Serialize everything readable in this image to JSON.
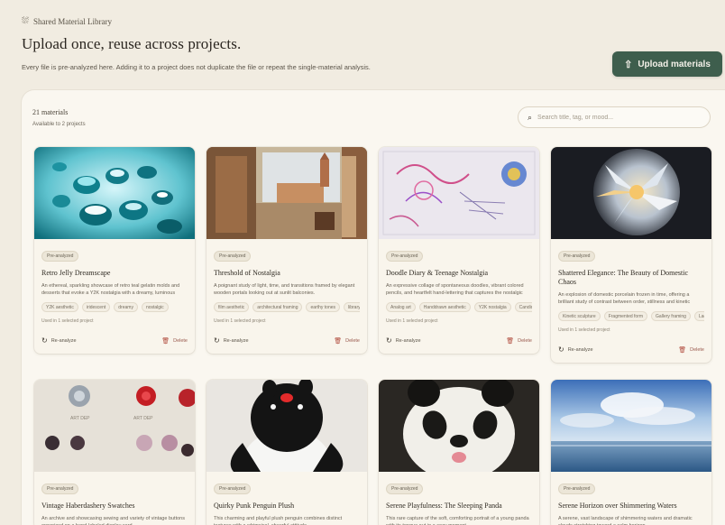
{
  "header": {
    "eyebrow": "Shared Material Library",
    "title": "Upload once, reuse across projects.",
    "description": "Every file is pre-analyzed here. Adding it to a project does not duplicate the file or repeat the single-material analysis."
  },
  "upload_button": {
    "label": "Upload materials",
    "icon": "upload-icon"
  },
  "library": {
    "count_label": "21 materials",
    "available_label": "Available to 2 projects",
    "search_placeholder": "Search title, tag, or mood..."
  },
  "cards": [
    {
      "badge": "Pre-analyzed",
      "title": "Retro Jelly Dreamscape",
      "description": "An ethereal, sparkling showcase of retro teal gelatin molds and desserts that evoke a Y2K nostalgia with a dreamy, luminous aesthetic.",
      "tags": [
        "Y2K aesthetic",
        "iridescent",
        "dreamy",
        "nostalgic"
      ],
      "used": "Used in 1 selected project",
      "reanalyze": "Re-analyze",
      "delete": "Delete"
    },
    {
      "badge": "Pre-analyzed",
      "title": "Threshold of Nostalgia",
      "description": "A poignant study of light, time, and transitions framed by elegant wooden portals looking out at sunlit balconies.",
      "tags": [
        "film aesthetic",
        "architectural framing",
        "earthy tones",
        "library"
      ],
      "used": "Used in 1 selected project",
      "reanalyze": "Re-analyze",
      "delete": "Delete"
    },
    {
      "badge": "Pre-analyzed",
      "title": "Doodle Diary & Teenage Nostalgia",
      "description": "An expressive collage of spontaneous doodles, vibrant colored pencils, and heartfelt hand-lettering that captures the nostalgic charm of a teenager's private notebook.",
      "tags": [
        "Analog art",
        "Handdrawn aesthetic",
        "Y2K nostalgia",
        "Candid"
      ],
      "used": "Used in 1 selected project",
      "reanalyze": "Re-analyze",
      "delete": "Delete"
    },
    {
      "badge": "Pre-analyzed",
      "title": "Shattered Elegance: The Beauty of Domestic Chaos",
      "description": "An explosion of domestic porcelain frozen in time, offering a brilliant study of contrast between order, stillness and kinetic energy in a single frame of light.",
      "tags": [
        "Kinetic sculpture",
        "Fragmented form",
        "Gallery framing",
        "Lacquer"
      ],
      "used": "Used in 1 selected project",
      "reanalyze": "Re-analyze",
      "delete": "Delete"
    },
    {
      "badge": "Pre-analyzed",
      "title": "Vintage Haberdashery Swatches",
      "description": "An archive and showcasing sewing and variety of vintage buttons organized on a hand-labeled display card.",
      "tags": [],
      "used": "",
      "reanalyze": "",
      "delete": ""
    },
    {
      "badge": "Pre-analyzed",
      "title": "Quirky Punk Penguin Plush",
      "description": "This charming and playful plush penguin combines distinct textures with a whimsical, cheerful attitude.",
      "tags": [],
      "used": "",
      "reanalyze": "",
      "delete": ""
    },
    {
      "badge": "Pre-analyzed",
      "title": "Serene Playfulness: The Sleeping Panda",
      "description": "This rare capture of the soft, comforting portrait of a young panda with its tongue out in a cozy moment.",
      "tags": [],
      "used": "",
      "reanalyze": "",
      "delete": ""
    },
    {
      "badge": "Pre-analyzed",
      "title": "Serene Horizon over Shimmering Waters",
      "description": "A serene, vast landscape of shimmering waters and dramatic clouds stretching toward a calm horizon.",
      "tags": [],
      "used": "",
      "reanalyze": "",
      "delete": ""
    }
  ],
  "colors": {
    "page_bg": "#f1ece1",
    "accent_button": "#3e5e4d",
    "delete_red": "#b0493b"
  }
}
